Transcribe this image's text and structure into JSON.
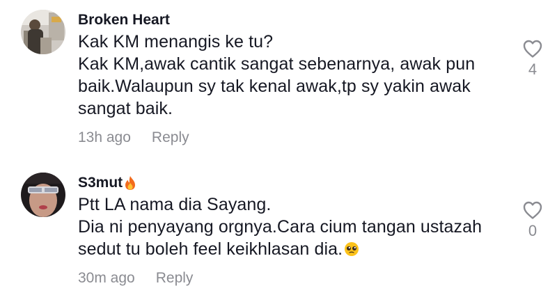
{
  "comments": [
    {
      "username": "Broken Heart",
      "avatar_icon": "user-photo-avatar",
      "lines": [
        "Kak KM menangis ke tu?",
        "Kak KM,awak cantik sangat sebenarnya, awak pun",
        "baik.Walaupun sy tak kenal awak,tp sy yakin awak",
        "sangat baik."
      ],
      "time": "13h ago",
      "reply_label": "Reply",
      "like_count": "4",
      "like_icon": "heart-outline-icon"
    },
    {
      "username": "S3mut",
      "username_emoji": "fire-icon",
      "avatar_icon": "user-photo-avatar",
      "lines": [
        "Ptt LA nama dia Sayang.",
        "Dia ni penyayang orgnya.Cara cium tangan ustazah",
        "sedut tu boleh feel keikhlasan dia."
      ],
      "line_end_emoji": "pleading-face-icon",
      "time": "30m ago",
      "reply_label": "Reply",
      "like_count": "0",
      "like_icon": "heart-outline-icon"
    }
  ],
  "colors": {
    "primary_text": "#161823",
    "secondary_text": "#8a8b91",
    "background": "#ffffff"
  }
}
